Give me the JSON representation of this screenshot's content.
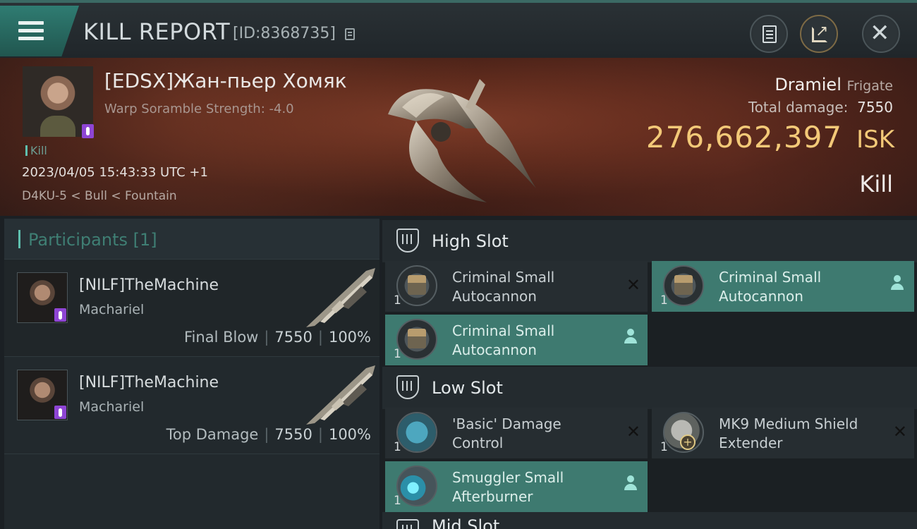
{
  "header": {
    "title": "KILL REPORT",
    "report_id": "[ID:8368735]"
  },
  "victim": {
    "name": "[EDSX]Жан-пьер Хомяк",
    "subtitle": "Warp Soramble Strength: -4.0",
    "tag": "Kill",
    "datetime": "2023/04/05 15:43:33 UTC +1",
    "location": "D4KU-5 < Bull < Fountain",
    "ship_name": "Dramiel",
    "ship_class": "Frigate",
    "total_damage_label": "Total damage:",
    "total_damage": "7550",
    "isk_value": "276,662,397",
    "isk_unit": "ISK",
    "result": "Kill"
  },
  "participants": {
    "header": "Participants [1]",
    "list": [
      {
        "name": "[NILF]TheMachine",
        "ship": "Machariel",
        "role": "Final Blow",
        "damage": "7550",
        "percent": "100%"
      },
      {
        "name": "[NILF]TheMachine",
        "ship": "Machariel",
        "role": "Top Damage",
        "damage": "7550",
        "percent": "100%"
      }
    ]
  },
  "slots": {
    "high": {
      "title": "High Slot",
      "modules": [
        {
          "qty": "1",
          "name": "Criminal Small Autocannon",
          "status": "destroyed",
          "icon": "autocannon-icon"
        },
        {
          "qty": "1",
          "name": "Criminal Small Autocannon",
          "status": "dropped",
          "icon": "autocannon-icon"
        },
        {
          "qty": "1",
          "name": "Criminal Small Autocannon",
          "status": "dropped",
          "icon": "autocannon-icon"
        }
      ]
    },
    "low": {
      "title": "Low Slot",
      "modules": [
        {
          "qty": "1",
          "name": "'Basic' Damage Control",
          "status": "destroyed",
          "icon": "damage-control-icon"
        },
        {
          "qty": "1",
          "name": "MK9 Medium Shield Extender",
          "status": "destroyed",
          "icon": "shield-extender-icon"
        },
        {
          "qty": "1",
          "name": "Smuggler Small Afterburner",
          "status": "dropped",
          "icon": "afterburner-icon"
        }
      ]
    },
    "mid": {
      "title": "Mid Slot"
    }
  },
  "colors": {
    "accent": "#3e7a70",
    "isk": "#f3c978",
    "hero_bg": "#5c2a1c"
  }
}
